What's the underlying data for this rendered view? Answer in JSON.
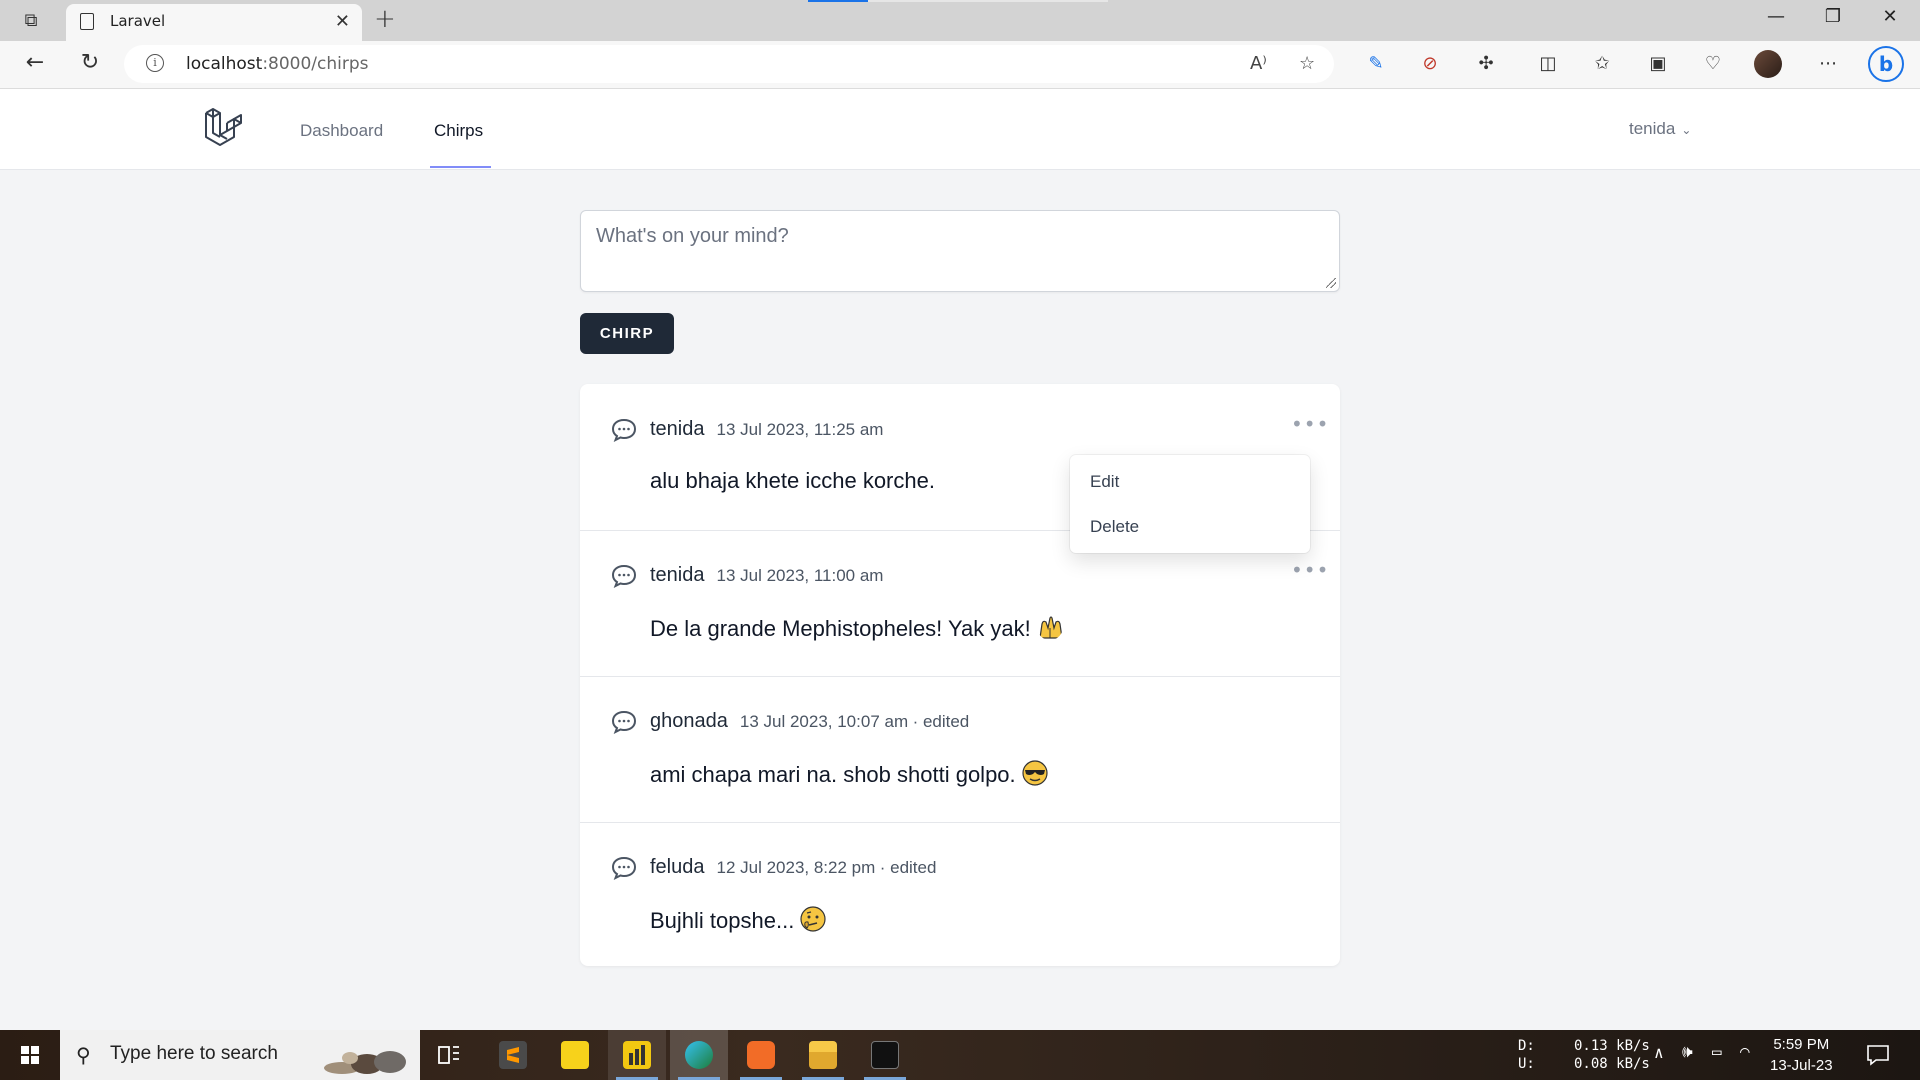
{
  "browser": {
    "tab_title": "Laravel",
    "url_host": "localhost",
    "url_path": ":8000/chirps"
  },
  "app": {
    "nav": {
      "dashboard": "Dashboard",
      "chirps": "Chirps",
      "user": "tenida"
    },
    "composer": {
      "placeholder": "What's on your mind?",
      "button": "CHIRP"
    },
    "chirps": [
      {
        "author": "tenida",
        "date": "13 Jul 2023, 11:25 am",
        "edited": "",
        "message": "alu bhaja khete icche korche.",
        "emoji": ""
      },
      {
        "author": "tenida",
        "date": "13 Jul 2023, 11:00 am",
        "edited": "",
        "message": "De la grande Mephistopheles! Yak yak!",
        "emoji": "raising-hands"
      },
      {
        "author": "ghonada",
        "date": "13 Jul 2023, 10:07 am",
        "edited": "· edited",
        "message": "ami chapa mari na. shob shotti golpo.",
        "emoji": "sunglasses-face"
      },
      {
        "author": "feluda",
        "date": "12 Jul 2023, 8:22 pm",
        "edited": "· edited",
        "message": "Bujhli topshe...",
        "emoji": "confused-face"
      }
    ],
    "dropdown": {
      "edit": "Edit",
      "delete": "Delete"
    }
  },
  "taskbar": {
    "search_placeholder": "Type here to search",
    "net_d_label": "D:",
    "net_u_label": "U:",
    "net_d": "0.13 kB/s",
    "net_u": "0.08 kB/s",
    "time": "5:59 PM",
    "date": "13-Jul-23"
  },
  "colors": {
    "accent_underline": "#818cf8",
    "button_bg": "#1f2937",
    "page_bg": "#f3f4f6"
  }
}
